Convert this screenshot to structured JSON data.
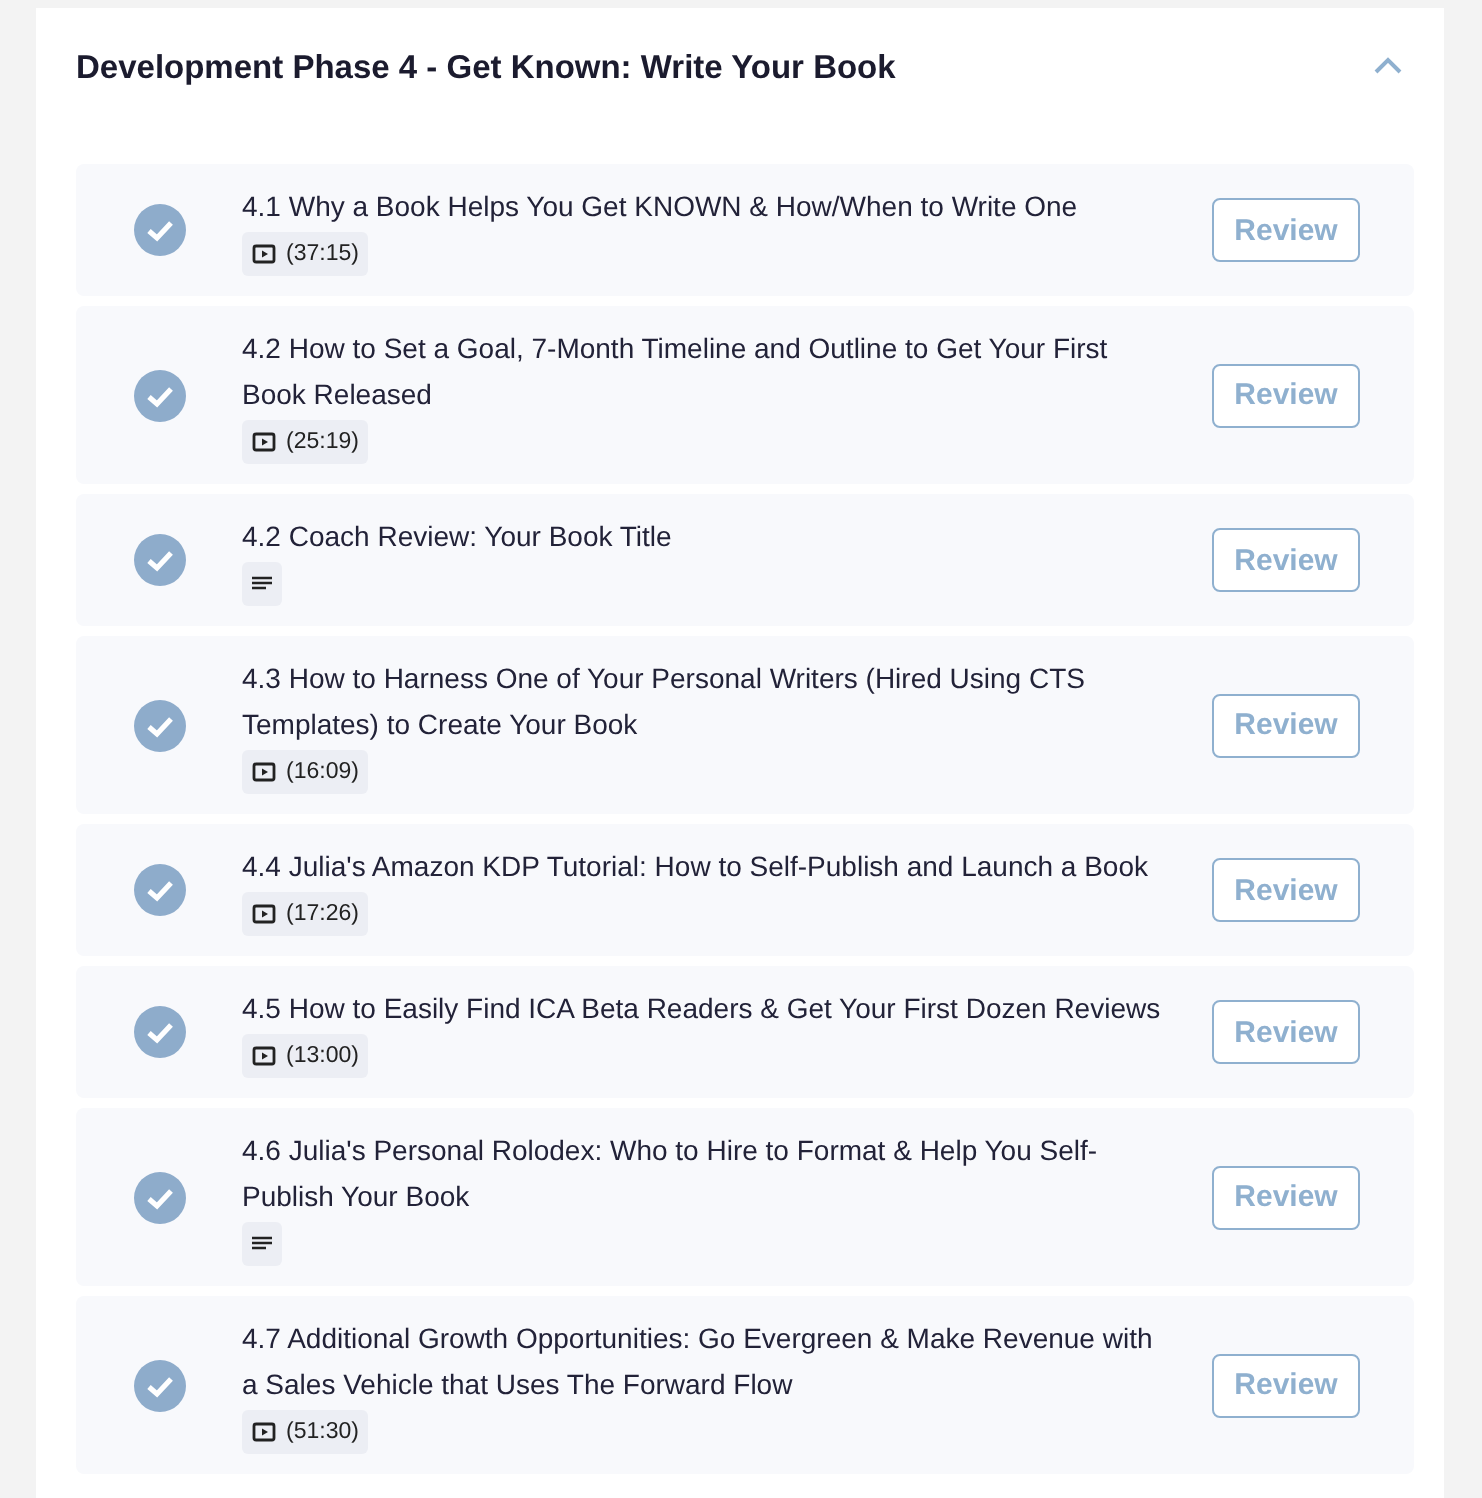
{
  "section": {
    "title": "Development Phase 4 - Get Known: Write Your Book",
    "expanded": true
  },
  "lessons": [
    {
      "title": "4.1 Why a Book Helps You Get KNOWN & How/When to Write One",
      "kind": "video",
      "duration": "(37:15)",
      "completed": true,
      "button": "Review"
    },
    {
      "title": "4.2 How to Set a Goal, 7-Month Timeline and Outline to Get Your First Book Released",
      "kind": "video",
      "duration": "(25:19)",
      "completed": true,
      "button": "Review"
    },
    {
      "title": "4.2 Coach Review: Your Book Title",
      "kind": "text",
      "completed": true,
      "button": "Review"
    },
    {
      "title": "4.3 How to Harness One of Your Personal Writers (Hired Using CTS Templates) to Create Your Book",
      "kind": "video",
      "duration": "(16:09)",
      "completed": true,
      "button": "Review"
    },
    {
      "title": "4.4 Julia's Amazon KDP Tutorial: How to Self-Publish and Launch a Book",
      "kind": "video",
      "duration": "(17:26)",
      "completed": true,
      "button": "Review"
    },
    {
      "title": "4.5 How to Easily Find ICA Beta Readers & Get Your First Dozen Reviews",
      "kind": "video",
      "duration": "(13:00)",
      "completed": true,
      "button": "Review"
    },
    {
      "title": "4.6 Julia's Personal Rolodex: Who to Hire to Format & Help You Self-Publish Your Book",
      "kind": "text",
      "completed": true,
      "button": "Review"
    },
    {
      "title": "4.7 Additional Growth Opportunities: Go Evergreen & Make Revenue with a Sales Vehicle that Uses The Forward Flow",
      "kind": "video",
      "duration": "(51:30)",
      "completed": true,
      "button": "Review"
    }
  ]
}
